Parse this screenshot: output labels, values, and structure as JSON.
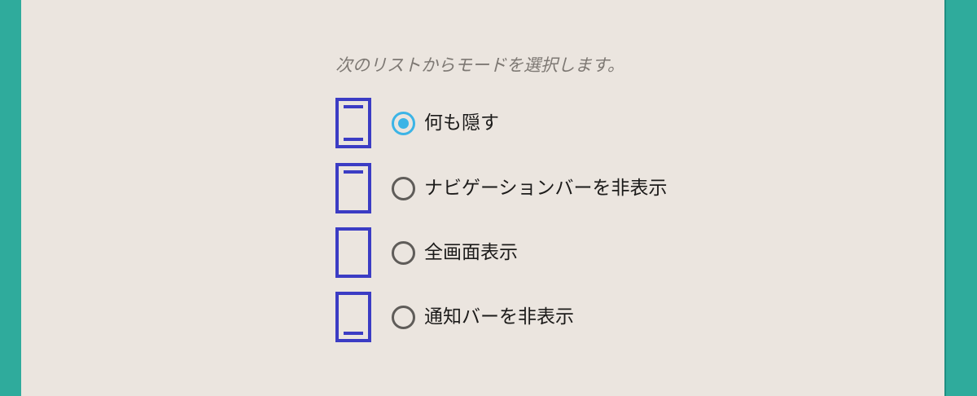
{
  "dialog": {
    "instruction": "次のリストからモードを選択します。",
    "options": [
      {
        "label": "何も隠す",
        "selected": true,
        "icon": "device-navbar-and-statusbar-icon"
      },
      {
        "label": "ナビゲーションバーを非表示",
        "selected": false,
        "icon": "device-statusbar-only-icon"
      },
      {
        "label": "全画面表示",
        "selected": false,
        "icon": "device-fullscreen-icon"
      },
      {
        "label": "通知バーを非表示",
        "selected": false,
        "icon": "device-navbar-only-icon"
      }
    ]
  },
  "colors": {
    "background": "#2fab9c",
    "panel": "#ebe5df",
    "icon_stroke": "#3b3cc4",
    "radio_selected": "#3cb4e6",
    "radio_unselected": "#5f5c59"
  }
}
